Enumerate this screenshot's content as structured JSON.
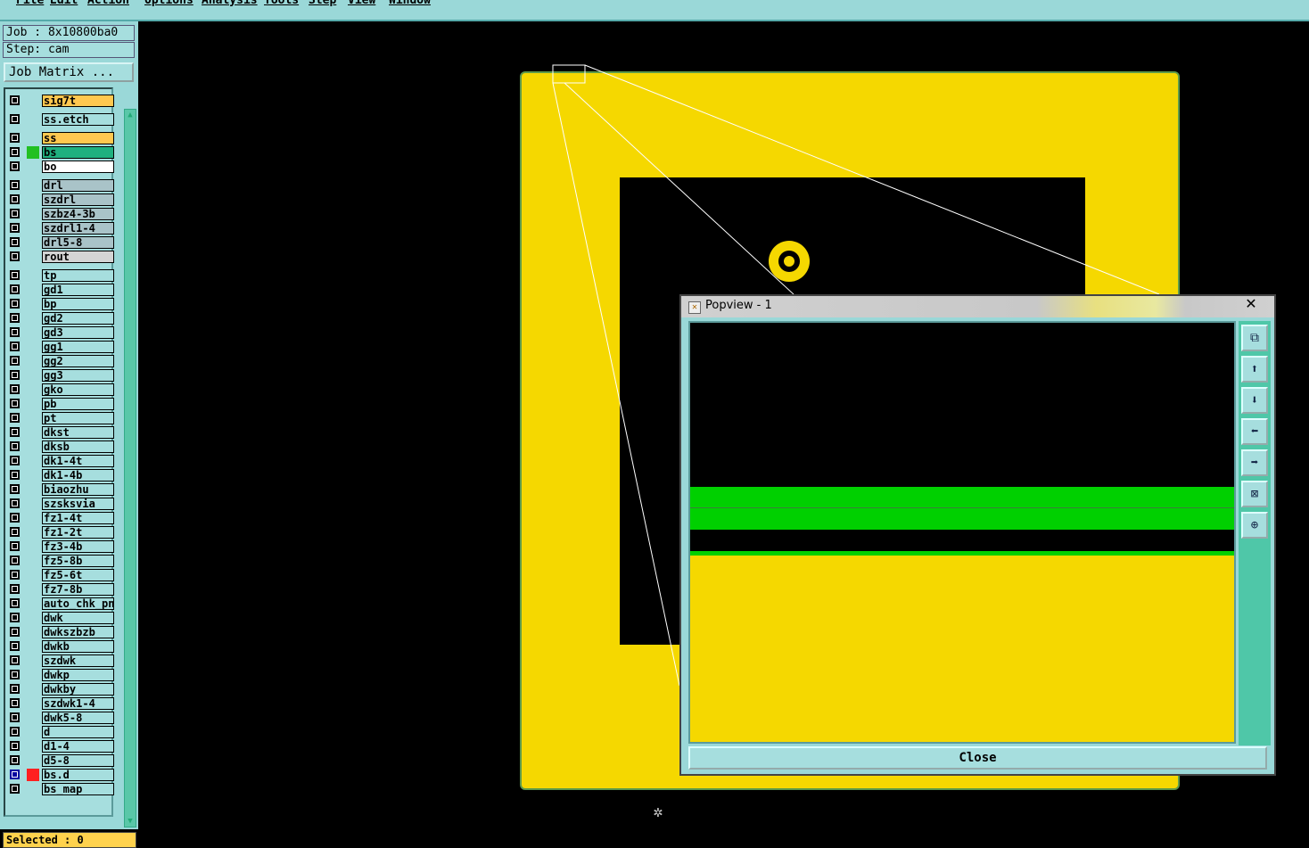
{
  "menubar": {
    "items": [
      "File",
      "Edit",
      "Action",
      "Options",
      "Analysis",
      "Tools",
      "Step",
      "View",
      "Window"
    ]
  },
  "job": {
    "job_label": "Job : 8x10800ba0",
    "step_label": "Step: cam",
    "matrix_button": "Job Matrix ..."
  },
  "layers": [
    {
      "name": "sig7t",
      "bg": "#ffc850",
      "swatch": ""
    },
    {
      "name": "ss.etch",
      "bg": "#a6dede",
      "swatch": ""
    },
    {
      "name": "ss",
      "bg": "#ffc850",
      "swatch": ""
    },
    {
      "name": "bs",
      "bg": "#1fb07f",
      "swatch": "#22c022"
    },
    {
      "name": "bo",
      "bg": "#ffffff",
      "swatch": ""
    },
    {
      "name": "drl",
      "bg": "#a9c3c8",
      "swatch": ""
    },
    {
      "name": "szdrl",
      "bg": "#a9c3c8",
      "swatch": ""
    },
    {
      "name": "szbz4-3b",
      "bg": "#a9c3c8",
      "swatch": ""
    },
    {
      "name": "szdrl1-4",
      "bg": "#a9c3c8",
      "swatch": ""
    },
    {
      "name": "drl5-8",
      "bg": "#a9c3c8",
      "swatch": ""
    },
    {
      "name": "rout",
      "bg": "#d4d4d4",
      "swatch": ""
    },
    {
      "name": "tp",
      "bg": "#a6dede",
      "swatch": ""
    },
    {
      "name": "gd1",
      "bg": "#a6dede",
      "swatch": ""
    },
    {
      "name": "bp",
      "bg": "#a6dede",
      "swatch": ""
    },
    {
      "name": "gd2",
      "bg": "#a6dede",
      "swatch": ""
    },
    {
      "name": "gd3",
      "bg": "#a6dede",
      "swatch": ""
    },
    {
      "name": "gg1",
      "bg": "#a6dede",
      "swatch": ""
    },
    {
      "name": "gg2",
      "bg": "#a6dede",
      "swatch": ""
    },
    {
      "name": "gg3",
      "bg": "#a6dede",
      "swatch": ""
    },
    {
      "name": "gko",
      "bg": "#a6dede",
      "swatch": ""
    },
    {
      "name": "pb",
      "bg": "#a6dede",
      "swatch": ""
    },
    {
      "name": "pt",
      "bg": "#a6dede",
      "swatch": ""
    },
    {
      "name": "dkst",
      "bg": "#a6dede",
      "swatch": ""
    },
    {
      "name": "dksb",
      "bg": "#a6dede",
      "swatch": ""
    },
    {
      "name": "dk1-4t",
      "bg": "#a6dede",
      "swatch": ""
    },
    {
      "name": "dk1-4b",
      "bg": "#a6dede",
      "swatch": ""
    },
    {
      "name": "biaozhu",
      "bg": "#a6dede",
      "swatch": ""
    },
    {
      "name": "szsksvia",
      "bg": "#a6dede",
      "swatch": ""
    },
    {
      "name": "fz1-4t",
      "bg": "#a6dede",
      "swatch": ""
    },
    {
      "name": "fz1-2t",
      "bg": "#a6dede",
      "swatch": ""
    },
    {
      "name": "fz3-4b",
      "bg": "#a6dede",
      "swatch": ""
    },
    {
      "name": "fz5-8b",
      "bg": "#a6dede",
      "swatch": ""
    },
    {
      "name": "fz5-6t",
      "bg": "#a6dede",
      "swatch": ""
    },
    {
      "name": "fz7-8b",
      "bg": "#a6dede",
      "swatch": ""
    },
    {
      "name": "auto_chk_pn",
      "bg": "#a6dede",
      "swatch": ""
    },
    {
      "name": "dwk",
      "bg": "#a6dede",
      "swatch": ""
    },
    {
      "name": "dwkszbzb",
      "bg": "#a6dede",
      "swatch": ""
    },
    {
      "name": "dwkb",
      "bg": "#a6dede",
      "swatch": ""
    },
    {
      "name": "szdwk",
      "bg": "#a6dede",
      "swatch": ""
    },
    {
      "name": "dwkp",
      "bg": "#a6dede",
      "swatch": ""
    },
    {
      "name": "dwkby",
      "bg": "#a6dede",
      "swatch": ""
    },
    {
      "name": "szdwk1-4",
      "bg": "#a6dede",
      "swatch": ""
    },
    {
      "name": "dwk5-8",
      "bg": "#a6dede",
      "swatch": ""
    },
    {
      "name": "d",
      "bg": "#a6dede",
      "swatch": ""
    },
    {
      "name": "d1-4",
      "bg": "#a6dede",
      "swatch": ""
    },
    {
      "name": "d5-8",
      "bg": "#a6dede",
      "swatch": ""
    },
    {
      "name": "bs.d",
      "bg": "#a6dede",
      "swatch": "#ff2020"
    },
    {
      "name": "bs_map",
      "bg": "#a6dede",
      "swatch": ""
    }
  ],
  "status": {
    "selected": "Selected : 0"
  },
  "colors": {
    "board_fill": "#f5d800",
    "signal_green": "#00d000",
    "panel_bg": "#9ad8d8",
    "scrollbar": "#59c7a8"
  },
  "popview": {
    "title": "Popview - 1",
    "close_label": "Close",
    "tool_icons": [
      "zoom-fit-icon",
      "pan-up-icon",
      "pan-down-icon",
      "pan-left-icon",
      "pan-right-icon",
      "zoom-out-icon",
      "zoom-in-icon"
    ]
  }
}
